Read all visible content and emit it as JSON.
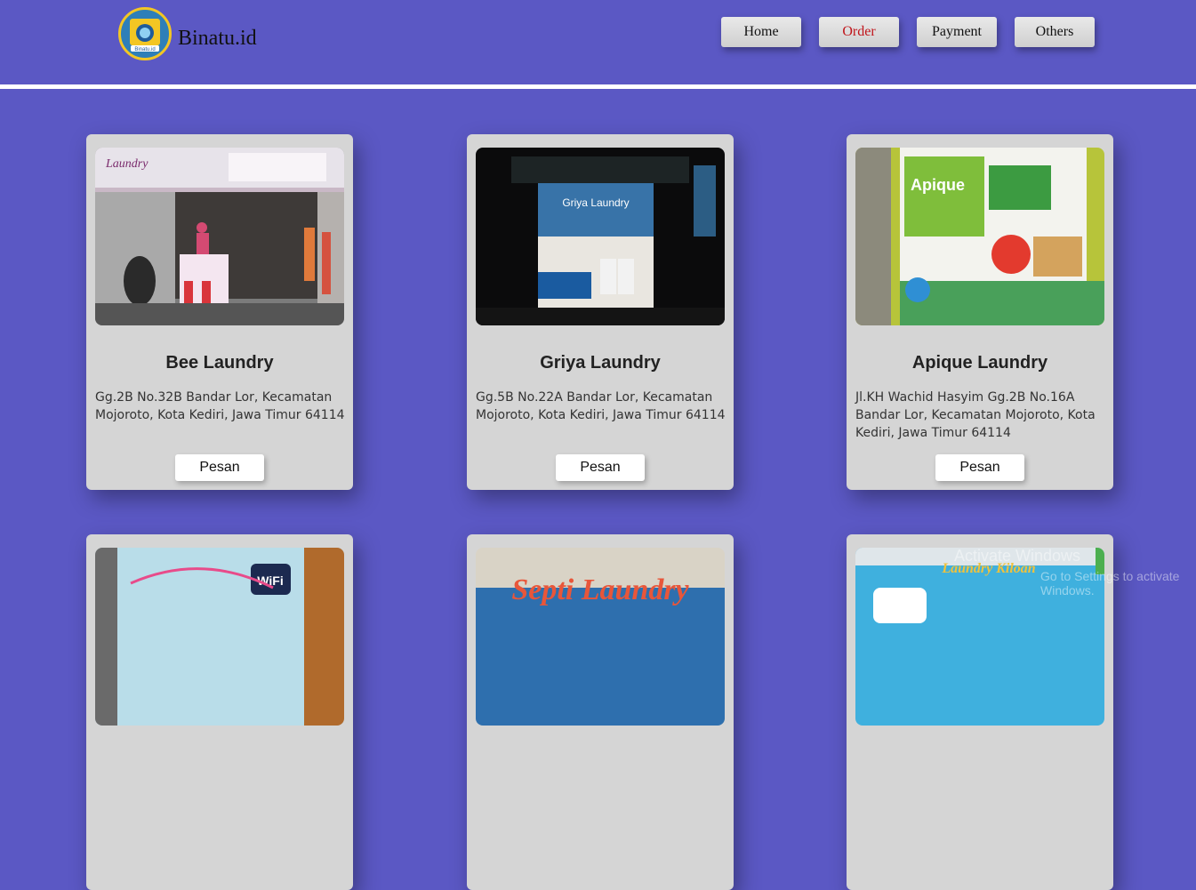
{
  "header": {
    "brand": "Binatu.id",
    "logo_text": "Binatu.id",
    "nav": [
      {
        "label": "Home",
        "active": false
      },
      {
        "label": "Order",
        "active": true
      },
      {
        "label": "Payment",
        "active": false
      },
      {
        "label": "Others",
        "active": false
      }
    ]
  },
  "cards": [
    {
      "title": "Bee Laundry",
      "address": "Gg.2B No.32B Bandar Lor, Kecamatan Mojoroto, Kota Kediri, Jawa Timur 64114",
      "button": "Pesan",
      "photo_sign": "Laundry"
    },
    {
      "title": "Griya Laundry",
      "address": "Gg.5B No.22A Bandar Lor, Kecamatan Mojoroto, Kota Kediri, Jawa Timur 64114",
      "button": "Pesan",
      "photo_sign": "Griya Laundry"
    },
    {
      "title": "Apique Laundry",
      "address": "Jl.KH Wachid Hasyim Gg.2B No.16A Bandar Lor, Kecamatan Mojoroto, Kota Kediri, Jawa Timur 64114",
      "button": "Pesan",
      "photo_sign": "Apique"
    },
    {
      "photo_sign": "WiFi"
    },
    {
      "photo_sign": "Septi Laundry"
    },
    {
      "photo_sign": "Laundry Kiloan"
    }
  ],
  "watermark": {
    "title": "Activate Windows",
    "subtitle": "Go to Settings to activate Windows."
  },
  "colors": {
    "background": "#5b58c4",
    "card": "#d5d5d5",
    "active_nav": "#c0151b"
  }
}
